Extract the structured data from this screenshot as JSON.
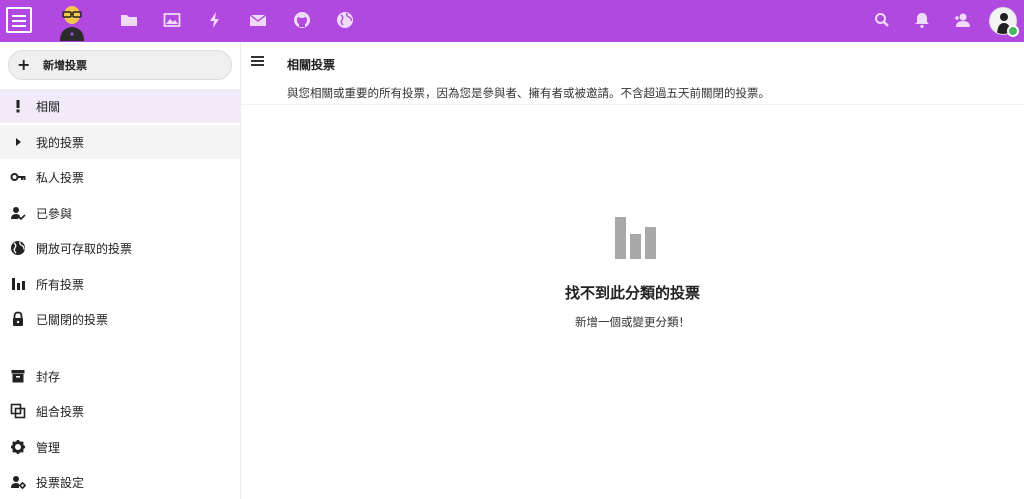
{
  "header": {
    "apps": [
      {
        "name": "files",
        "icon": "folder-icon"
      },
      {
        "name": "photos",
        "icon": "image-icon"
      },
      {
        "name": "activity",
        "icon": "lightning-icon"
      },
      {
        "name": "mail",
        "icon": "mail-icon"
      },
      {
        "name": "github",
        "icon": "github-icon"
      },
      {
        "name": "external-sites",
        "icon": "globe-icon"
      }
    ],
    "right_icons": [
      "search-icon",
      "bell-icon",
      "contacts-icon"
    ],
    "accent_color": "#b149e0",
    "status_color": "#46ba61"
  },
  "sidebar": {
    "new_poll": "新增投票",
    "items": [
      {
        "label": "相關",
        "icon": "exclamation-icon",
        "state": "active"
      },
      {
        "label": "我的投票",
        "icon": "caret-right-icon",
        "state": "hover"
      },
      {
        "label": "私人投票",
        "icon": "key-icon"
      },
      {
        "label": "已參與",
        "icon": "user-check-icon"
      },
      {
        "label": "開放可存取的投票",
        "icon": "globe-icon"
      },
      {
        "label": "所有投票",
        "icon": "bar-chart-icon"
      },
      {
        "label": "已關閉的投票",
        "icon": "lock-icon"
      },
      {
        "label": "封存",
        "icon": "archive-icon"
      },
      {
        "label": "組合投票",
        "icon": "combine-icon"
      },
      {
        "label": "管理",
        "icon": "gear-icon"
      },
      {
        "label": "投票設定",
        "icon": "user-settings-icon"
      }
    ]
  },
  "main": {
    "title": "相關投票",
    "description": "與您相關或重要的所有投票，因為您是參與者、擁有者或被邀請。不含超過五天前關閉的投票。",
    "empty_title": "找不到此分類的投票",
    "empty_subtitle": "新增一個或變更分類！"
  }
}
